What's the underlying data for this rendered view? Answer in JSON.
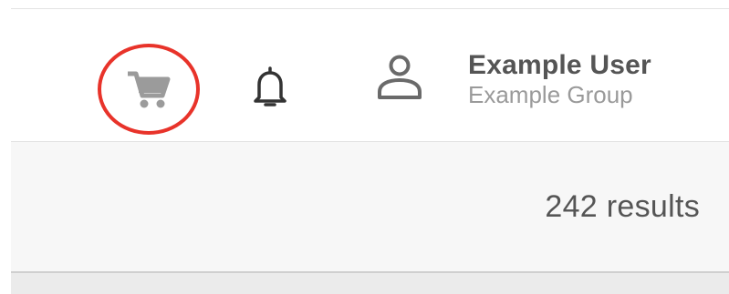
{
  "header": {
    "cart": {
      "icon": "shopping-cart-icon",
      "highlight_color": "#e8332a"
    },
    "notifications": {
      "icon": "bell-icon"
    },
    "user": {
      "icon": "person-icon",
      "name": "Example User",
      "group": "Example Group"
    }
  },
  "results": {
    "count_text": "242 results"
  }
}
